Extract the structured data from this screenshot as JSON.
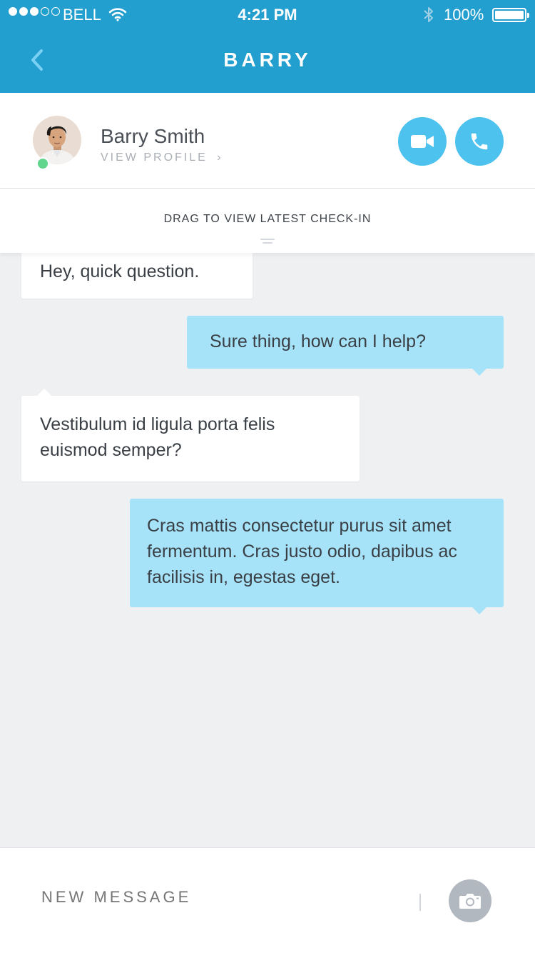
{
  "status_bar": {
    "carrier": "BELL",
    "time": "4:21 PM",
    "battery": "100%",
    "signal_strength": 3,
    "signal_max": 5
  },
  "nav": {
    "title": "BARRY",
    "back_icon": "chevron-left-icon"
  },
  "contact": {
    "name": "Barry Smith",
    "view_profile": "VIEW PROFILE",
    "chevron": "›",
    "online": true,
    "online_color": "#5fd58e",
    "actions": [
      {
        "name": "video-call",
        "icon": "video-camera-icon"
      },
      {
        "name": "voice-call",
        "icon": "phone-icon"
      }
    ]
  },
  "checkin": {
    "label": "DRAG TO VIEW LATEST CHECK-IN"
  },
  "messages": [
    {
      "direction": "incoming",
      "text": "Hey, quick question."
    },
    {
      "direction": "outgoing",
      "text": "Sure thing, how can I help?"
    },
    {
      "direction": "incoming",
      "text": "Vestibulum id ligula porta felis euismod semper?"
    },
    {
      "direction": "outgoing",
      "text": "Cras mattis consectetur purus sit amet fermentum. Cras justo odio, dapibus ac facilisis in, egestas eget."
    }
  ],
  "composer": {
    "placeholder": "NEW MESSAGE",
    "value": "",
    "camera_icon": "camera-icon"
  },
  "colors": {
    "brand": "#239fcf",
    "action": "#4ec2ee",
    "outgoing_bubble": "#a7e3f8",
    "incoming_bubble": "#ffffff",
    "background": "#eff0f2"
  }
}
